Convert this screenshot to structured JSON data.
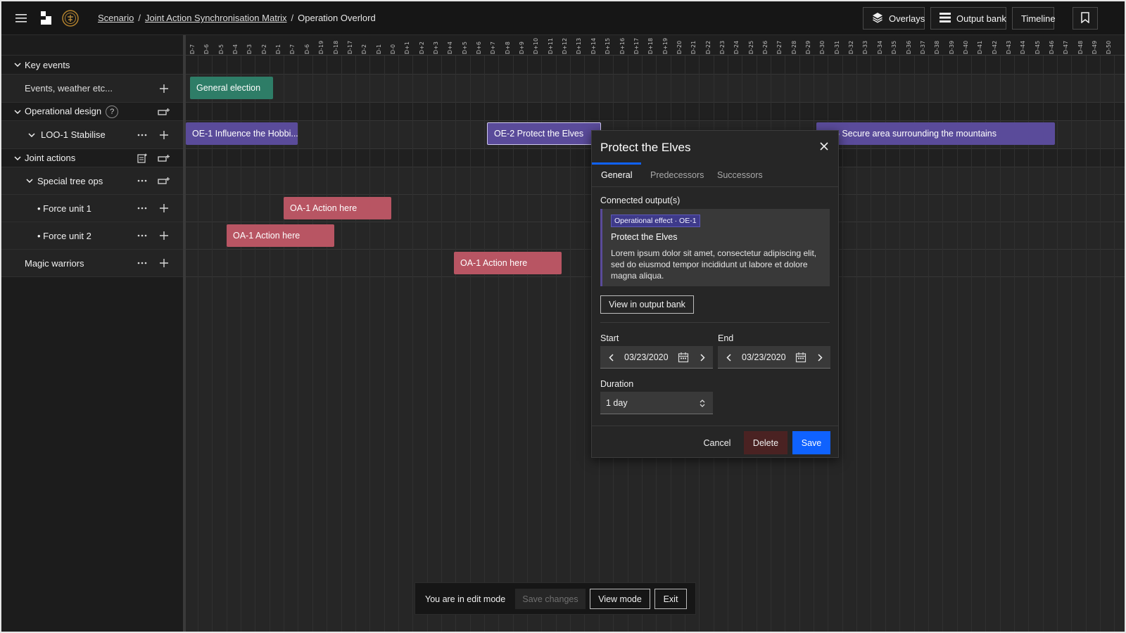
{
  "topbar": {
    "breadcrumb": {
      "scenario": "Scenario",
      "sep1": "/",
      "matrix": "Joint Action Synchronisation Matrix",
      "sep2": "/",
      "current": "Operation Overlord"
    },
    "overlays_label": "Overlays",
    "output_bank_label": "Output bank",
    "timeline_label": "Timeline"
  },
  "days": [
    "D-7",
    "D-6",
    "D-5",
    "D-4",
    "D-3",
    "D-2",
    "D-1",
    "D-7",
    "D-6",
    "D-19",
    "D-18",
    "D-17",
    "D-2",
    "D-1",
    "D-0",
    "D+1",
    "D+2",
    "D+3",
    "D+4",
    "D+5",
    "D+6",
    "D+7",
    "D+8",
    "D+9",
    "D+10",
    "D+11",
    "D+12",
    "D+13",
    "D+14",
    "D+15",
    "D+16",
    "D+17",
    "D+18",
    "D+19",
    "D-20",
    "D-21",
    "D-22",
    "D-23",
    "D-24",
    "D-25",
    "D-26",
    "D-27",
    "D-28",
    "D-29",
    "D-30",
    "D-31",
    "D-32",
    "D-33",
    "D-34",
    "D-35",
    "D-36",
    "D-37",
    "D-38",
    "D-39",
    "D-40",
    "D-41",
    "D-42",
    "D-43",
    "D-44",
    "D-45",
    "D-46",
    "D-47",
    "D-48",
    "D-49",
    "D-50"
  ],
  "left_panel": {
    "key_events": "Key events",
    "events_weather": "Events, weather etc...",
    "operational_design": "Operational design",
    "help": "?",
    "loo1": "LOO-1 Stabilise",
    "joint_actions": "Joint actions",
    "special_tree_ops": "Special tree ops",
    "force_unit_1": "Force unit 1",
    "force_unit_2": "Force unit 2",
    "magic_warriors": "Magic warriors"
  },
  "bars": {
    "general_election": "General election",
    "oe1": "OE-1 Influence the Hobbi...",
    "oe2": "OE-2 Protect the Elves",
    "oe3": "5 Secure area surrounding the mountains",
    "oa_fu1": "OA-1 Action here",
    "oa_fu2": "OA-1 Action here",
    "oa_magic": "OA-1 Action here"
  },
  "colors": {
    "green_bar": "#2e7d67",
    "purple_bar": "#5a4b9a",
    "red_bar": "#b85563",
    "primary_blue": "#0f62fe",
    "danger_dark": "#4a2222"
  },
  "dialog": {
    "title": "Protect the Elves",
    "tabs": [
      "General",
      "Predecessors",
      "Successors"
    ],
    "connected_outputs_label": "Connected output(s)",
    "card_tag": "Operational effect · OE-1",
    "card_title": "Protect the Elves",
    "card_body": "Lorem ipsum dolor sit amet, consectetur adipiscing elit, sed do eiusmod tempor incididunt ut labore et dolore magna aliqua.",
    "view_output_bank": "View in output bank",
    "start_label": "Start",
    "end_label": "End",
    "start_value": "03/23/2020",
    "end_value": "03/23/2020",
    "duration_label": "Duration",
    "duration_value": "1 day",
    "cancel": "Cancel",
    "delete": "Delete",
    "save": "Save"
  },
  "edit_bar": {
    "message": "You are in edit mode",
    "save_changes": "Save changes",
    "view_mode": "View mode",
    "exit": "Exit"
  },
  "icons": [
    "menu-icon",
    "app-logo-icon",
    "crest-icon",
    "layers-icon",
    "list-icon",
    "bookmark-icon",
    "chevron-down-icon",
    "plus-icon",
    "more-icon",
    "add-row-icon",
    "notes-icon",
    "close-icon",
    "chevron-left-icon",
    "chevron-right-icon",
    "calendar-icon",
    "stepper-icon"
  ]
}
